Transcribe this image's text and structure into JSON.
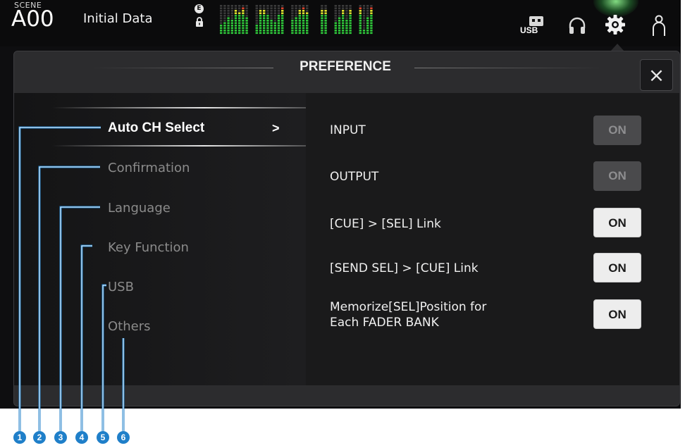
{
  "topbar": {
    "scene_label": "SCENE",
    "scene_number": "A00",
    "scene_title": "Initial Data",
    "e_badge": "E",
    "usb_label": "USB",
    "accent_glow": "#5fe36a"
  },
  "meters": {
    "colors": {
      "green": "#2fc63a",
      "yellow": "#dfe22e",
      "red": "#e2452f",
      "dim": "#3a3a3a"
    },
    "levels": [
      0.35,
      0.45,
      0.6,
      0.5,
      0.8,
      0.75,
      0.9,
      0.6,
      0.3,
      0.85,
      0.8,
      0.7,
      0.5,
      0.45,
      0.65,
      0.95,
      0.5,
      0.55,
      0.8,
      0.9,
      0.75,
      0.85,
      0.8,
      0.45,
      0.6,
      0.8,
      0.5,
      0.85,
      0.9,
      0.2,
      0.55,
      0.95
    ]
  },
  "panel": {
    "title": "PREFERENCE",
    "close_glyph": "×"
  },
  "menu": {
    "items": [
      {
        "label": "Auto CH Select",
        "selected": true
      },
      {
        "label": "Confirmation",
        "selected": false
      },
      {
        "label": "Language",
        "selected": false
      },
      {
        "label": "Key Function",
        "selected": false
      },
      {
        "label": "USB",
        "selected": false
      },
      {
        "label": "Others",
        "selected": false
      }
    ],
    "chevron": ">"
  },
  "settings": [
    {
      "label": "INPUT",
      "button": "ON",
      "enabled": false
    },
    {
      "label": "OUTPUT",
      "button": "ON",
      "enabled": false
    },
    {
      "label": "[CUE] > [SEL] Link",
      "button": "ON",
      "enabled": true
    },
    {
      "label": "[SEND SEL] > [CUE] Link",
      "button": "ON",
      "enabled": true
    },
    {
      "label": "Memorize[SEL]Position for\nEach FADER BANK",
      "button": "ON",
      "enabled": true
    }
  ],
  "callouts": {
    "color": "#1f7fc9",
    "numbers": [
      "1",
      "2",
      "3",
      "4",
      "5",
      "6"
    ]
  }
}
